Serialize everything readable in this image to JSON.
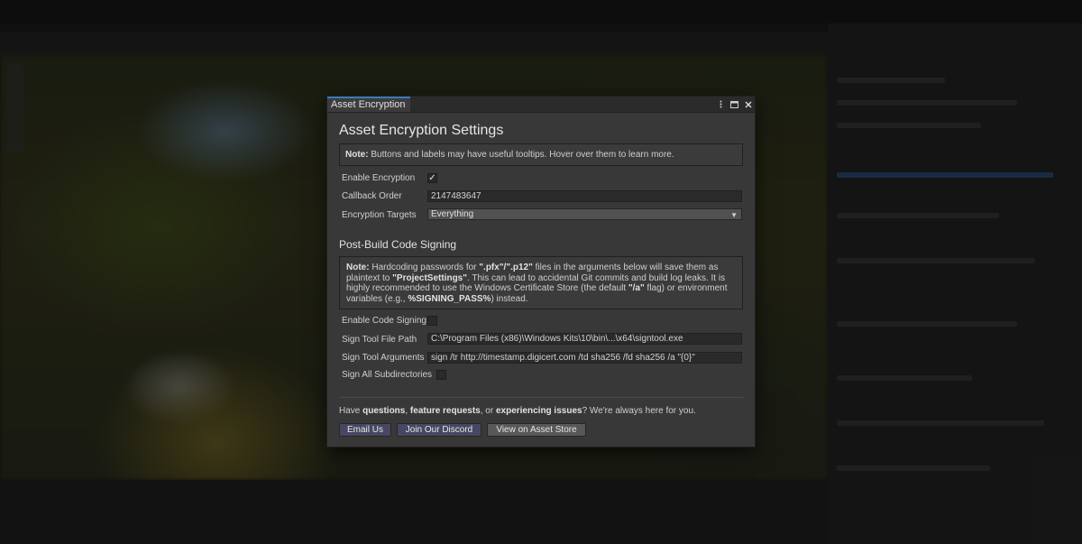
{
  "window": {
    "tab_title": "Asset Encryption",
    "icons": [
      "kebab-menu-icon",
      "maximize-icon",
      "close-icon"
    ]
  },
  "settings": {
    "heading": "Asset Encryption Settings",
    "note_prefix": "Note:",
    "note_text": " Buttons and labels may have useful tooltips. Hover over them to learn more.",
    "enable_encryption_label": "Enable Encryption",
    "enable_encryption_checked": true,
    "callback_order_label": "Callback Order",
    "callback_order_value": "2147483647",
    "encryption_targets_label": "Encryption Targets",
    "encryption_targets_value": "Everything"
  },
  "signing": {
    "heading": "Post-Build Code Signing",
    "note_prefix": "Note:",
    "note_part1": " Hardcoding passwords for ",
    "note_ext": "\".pfx\"/\".p12\"",
    "note_part2": " files in the arguments below will save them as plaintext to ",
    "note_ps": "\"ProjectSettings\"",
    "note_part3": ". This can lead to accidental Git commits and build log leaks. It is highly recommended to use the Windows Certificate Store (the default ",
    "note_flag": "\"/a\"",
    "note_part4": " flag) or environment variables (e.g., ",
    "note_var": "%SIGNING_PASS%",
    "note_part5": ") instead.",
    "enable_code_signing_label": "Enable Code Signing",
    "enable_code_signing_checked": false,
    "sign_tool_path_label": "Sign Tool File Path",
    "sign_tool_path_value": "C:\\Program Files (x86)\\Windows Kits\\10\\bin\\...\\x64\\signtool.exe",
    "sign_tool_args_label": "Sign Tool Arguments",
    "sign_tool_args_value": "sign /tr http://timestamp.digicert.com /td sha256 /fd sha256 /a \"{0}\"",
    "sign_all_subdirs_label": "Sign All Subdirectories",
    "sign_all_subdirs_checked": false
  },
  "footer": {
    "text_part1": "Have ",
    "text_b1": "questions",
    "text_part2": ", ",
    "text_b2": "feature requests",
    "text_part3": ", or ",
    "text_b3": "experiencing issues",
    "text_part4": "? We're always here for you.",
    "email_button": "Email Us",
    "discord_button": "Join Our Discord",
    "asset_store_button": "View on Asset Store"
  },
  "colors": {
    "accent_tab": "#3a79bb",
    "primary_button": "#474763",
    "window_bg": "#383838"
  }
}
